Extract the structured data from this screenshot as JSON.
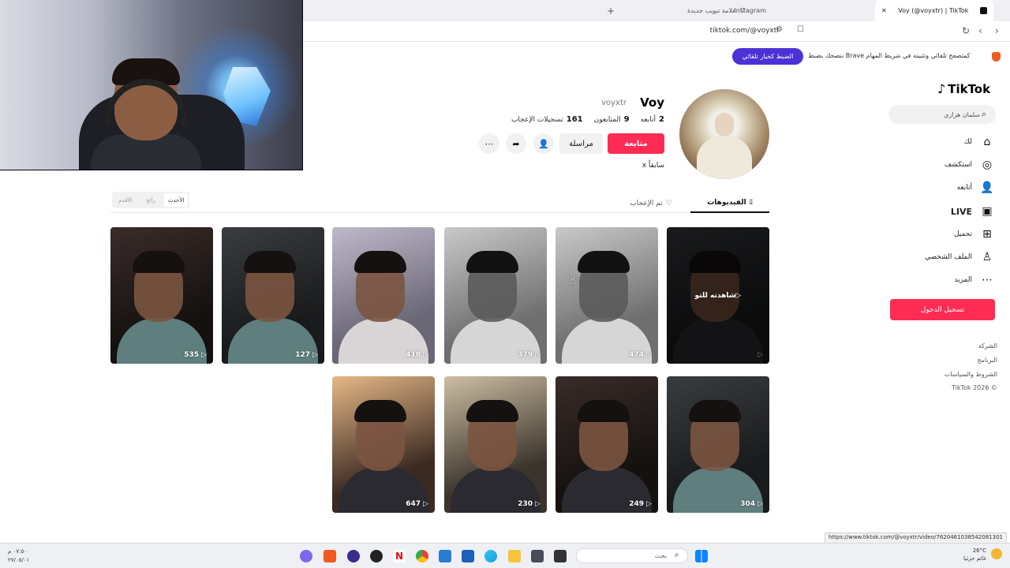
{
  "browser": {
    "tabs": [
      {
        "label": "Voy (@voyxtr) | TikTok",
        "active": true
      },
      {
        "label": "Instagram",
        "active": false
      },
      {
        "label": "علامة تبويب جديدة",
        "active": false
      }
    ],
    "new_tab_glyph": "+",
    "url": "tiktok.com/@voyxtr"
  },
  "brave_bar": {
    "message": "ننصحك بضبط Brave كمتصفح تلقائي وتثبيته في شريط المهام",
    "button_label": "الضبط كخيار تلقائي"
  },
  "sidebar": {
    "logo": "TikTok",
    "search_placeholder": "سلمان هزازي",
    "items": [
      {
        "label": "لك",
        "icon": "home-icon"
      },
      {
        "label": "استكشف",
        "icon": "compass-icon"
      },
      {
        "label": "أتابعه",
        "icon": "following-icon"
      },
      {
        "label": "LIVE",
        "icon": "live-icon"
      },
      {
        "label": "تحميل",
        "icon": "upload-icon"
      },
      {
        "label": "الملف الشخصي",
        "icon": "profile-icon"
      },
      {
        "label": "المزيد",
        "icon": "more-icon"
      }
    ],
    "login_label": "تسجيل الدخول",
    "footer": [
      "الشركة",
      "البرنامج",
      "الشروط والسياسات",
      "TikTok 2026 ©"
    ]
  },
  "profile": {
    "display_name": "Voy",
    "username": "voyxtr",
    "stats": [
      {
        "value": "2",
        "label": "أتابعه"
      },
      {
        "value": "9",
        "label": "المتابعون"
      },
      {
        "value": "161",
        "label": "تسجيلات الإعجاب"
      }
    ],
    "follow_label": "متابعة",
    "message_label": "مراسلة",
    "bio": "x سابقاً"
  },
  "tabs": {
    "videos": "الفيديوهات",
    "liked": "تم الإعجاب",
    "sort": [
      "الأحدث",
      "رائج",
      "الأقدم"
    ]
  },
  "videos": [
    {
      "views": "",
      "overlay": "شاهدته للتو",
      "style": "v-mid v-hood-dark"
    },
    {
      "views": "474",
      "overlay": "",
      "style": "v-gray v-hood-white"
    },
    {
      "views": "379",
      "overlay": "",
      "style": "v-gray v-hood-white"
    },
    {
      "views": "418",
      "overlay": "",
      "style": "v-light v-hood-white"
    },
    {
      "views": "127",
      "overlay": "",
      "style": "v-mid"
    },
    {
      "views": "535",
      "overlay": "",
      "style": "v-dark"
    },
    {
      "views": "304",
      "overlay": "",
      "style": "v-mid"
    },
    {
      "views": "249",
      "overlay": "",
      "style": "v-dark v-hood-dark"
    },
    {
      "views": "230",
      "overlay": "",
      "style": "v-beige v-hood-dark"
    },
    {
      "views": "647",
      "overlay": "",
      "style": "v-warm v-hood-dark"
    }
  ],
  "status_url": "https://www.tiktok.com/@voyxtr/video/7620461038542081301",
  "taskbar": {
    "search_placeholder": "بحث",
    "clock_time": "٠٧:٥٠ م",
    "clock_date": "٢٧/٠٥/٠١",
    "weather_temp": "26°C",
    "weather_desc": "غائم جزئيا",
    "notification_count": "1"
  }
}
